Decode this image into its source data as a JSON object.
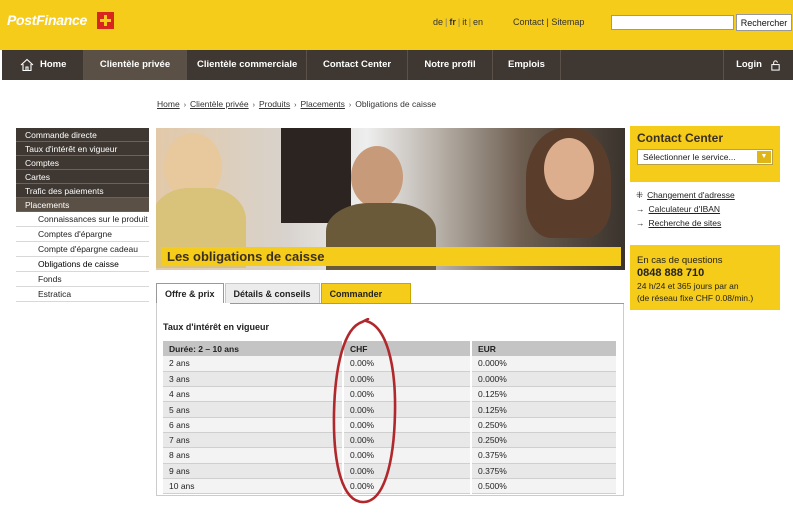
{
  "header": {
    "logo_text": "PostFinance",
    "languages": [
      "de",
      "fr",
      "it",
      "en"
    ],
    "contact_label": "Contact",
    "sitemap_label": "Sitemap",
    "search_button": "Rechercher",
    "search_value": ""
  },
  "nav": {
    "home": "Home",
    "private": "Clientèle privée",
    "business": "Clientèle commerciale",
    "contact_center": "Contact Center",
    "profile": "Notre profil",
    "jobs": "Emplois",
    "login": "Login"
  },
  "breadcrumb": {
    "items": [
      "Home",
      "Clientèle privée",
      "Produits",
      "Placements"
    ],
    "current": "Obligations de caisse"
  },
  "sidebar": {
    "items": [
      "Commande directe",
      "Taux d'intérêt en vigueur",
      "Comptes",
      "Cartes",
      "Trafic des paiements",
      "Placements"
    ],
    "sub_items": [
      "Connaissances sur le produit",
      "Comptes d'épargne",
      "Compte d'épargne cadeau",
      "Obligations de caisse",
      "Fonds",
      "Estratica"
    ]
  },
  "hero": {
    "title": "Les obligations de caisse"
  },
  "tabs": [
    "Offre & prix",
    "Détails & conseils",
    "Commander"
  ],
  "rates": {
    "title": "Taux d'intérêt en vigueur",
    "headers": [
      "Durée: 2 – 10 ans",
      "CHF",
      "EUR"
    ],
    "rows": [
      [
        "2 ans",
        "0.00%",
        "0.000%"
      ],
      [
        "3 ans",
        "0.00%",
        "0.000%"
      ],
      [
        "4 ans",
        "0.00%",
        "0.125%"
      ],
      [
        "5 ans",
        "0.00%",
        "0.125%"
      ],
      [
        "6 ans",
        "0.00%",
        "0.250%"
      ],
      [
        "7 ans",
        "0.00%",
        "0.250%"
      ],
      [
        "8 ans",
        "0.00%",
        "0.375%"
      ],
      [
        "9 ans",
        "0.00%",
        "0.375%"
      ],
      [
        "10 ans",
        "0.00%",
        "0.500%"
      ]
    ]
  },
  "contact_center": {
    "title": "Contact Center",
    "select_value": "Sélectionner le service...",
    "links": [
      "Changement d'adresse",
      "Calculateur d'IBAN",
      "Recherche de sites"
    ],
    "questions": "En cas de questions",
    "phone": "0848 888 710",
    "note1": "24 h/24 et 365 jours par an",
    "note2": "(de réseau fixe CHF 0.08/min.)"
  },
  "colors": {
    "brand_yellow": "#f6cc1a",
    "nav_dark": "#3f3832",
    "annotation_red": "#b0282c"
  }
}
